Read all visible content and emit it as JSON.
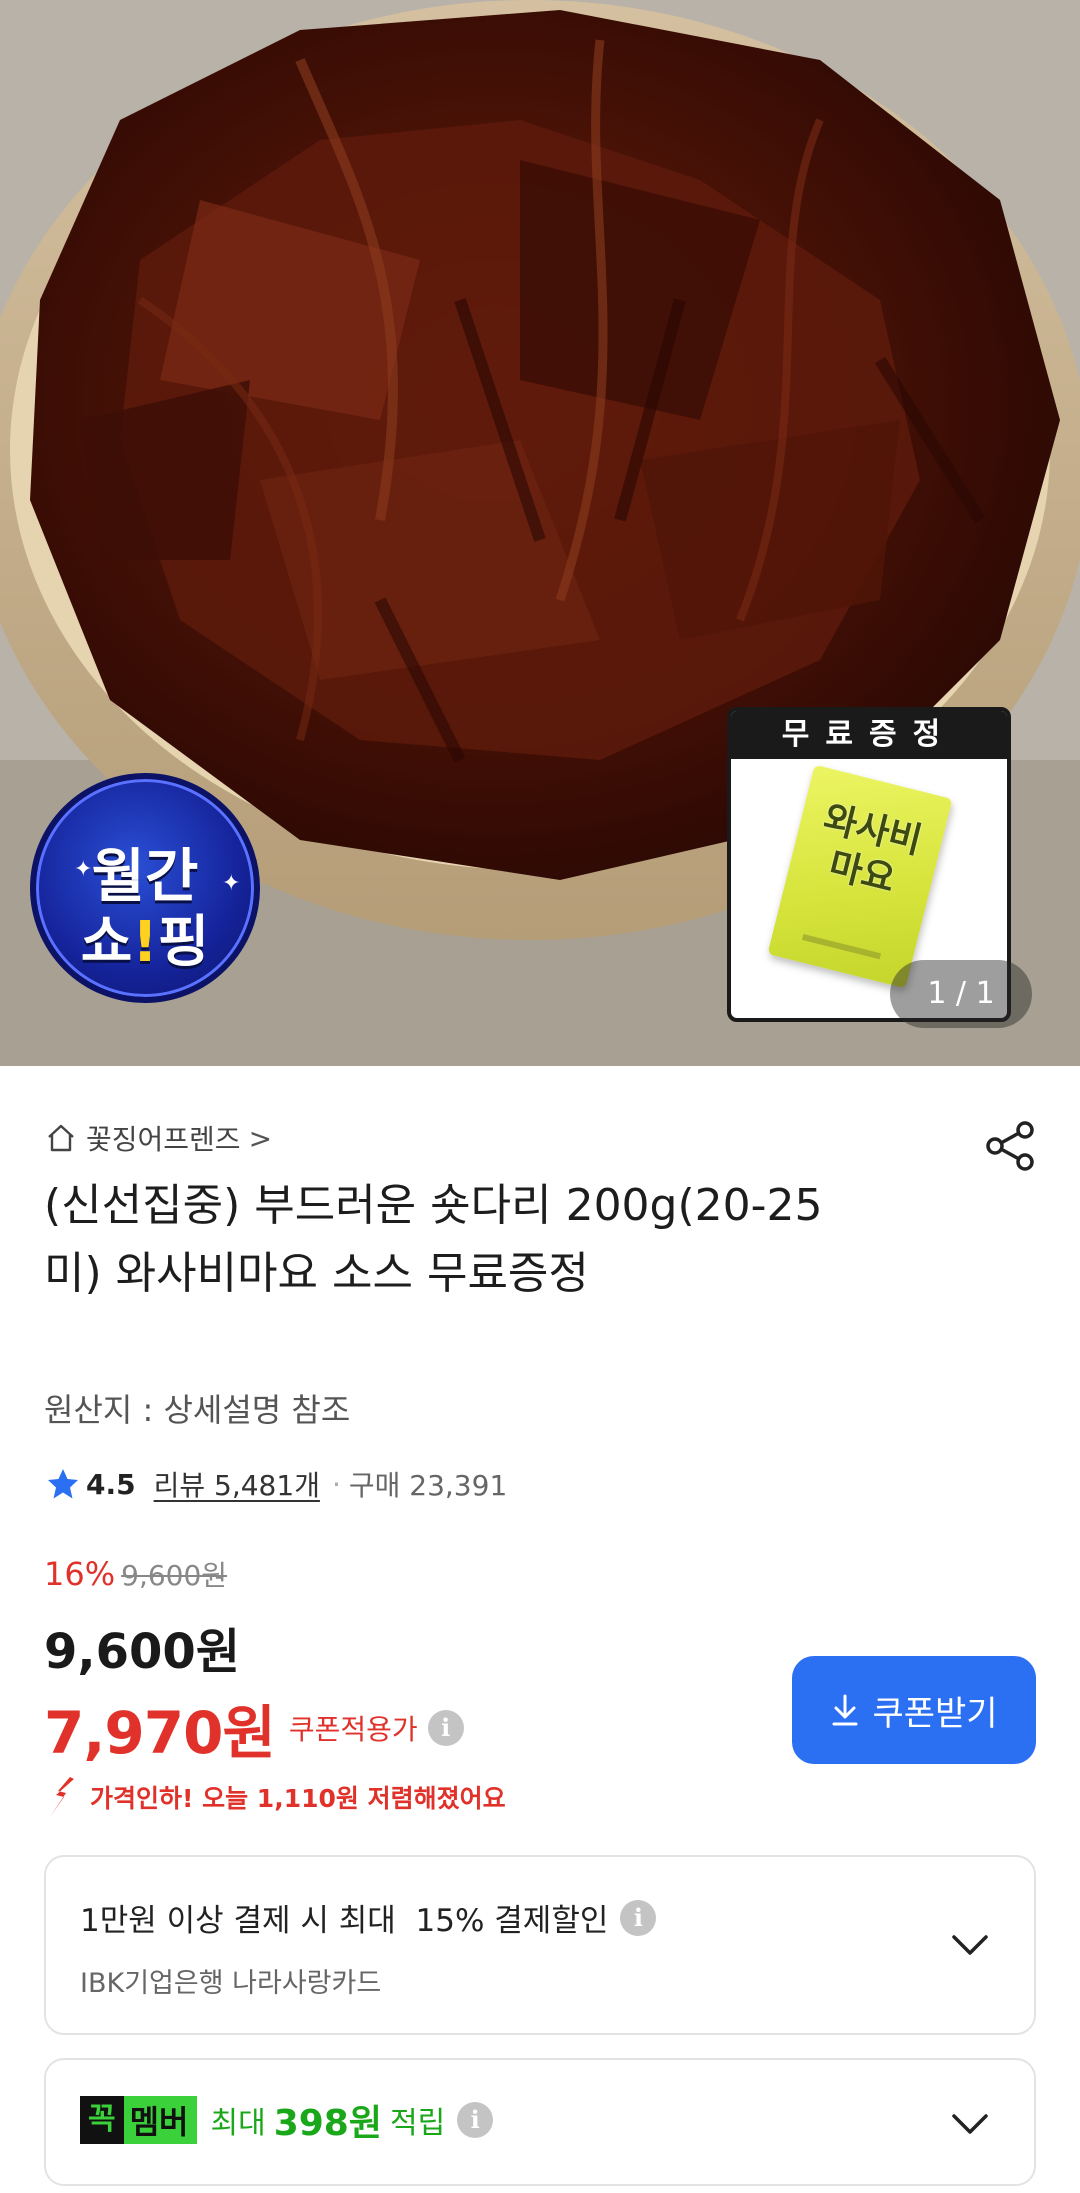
{
  "hero": {
    "gift_label": "무료증정",
    "sachet_text": "와사비마요",
    "pager": "1 / 1",
    "badge_line1": "월간",
    "badge_line2_a": "쇼",
    "badge_line2_excl": "!",
    "badge_line2_b": "핑"
  },
  "store": {
    "name": "꽃징어프렌즈",
    "chevron": ">"
  },
  "product": {
    "title": "(신선집중) 부드러운 숏다리 200g(20-25미) 와사비마요 소스 무료증정",
    "origin": "원산지 : 상세설명 참조"
  },
  "rating": {
    "score": "4.5",
    "reviews": "리뷰 5,481개",
    "separator": "·",
    "purchases": "구매 23,391"
  },
  "price": {
    "discount_pct": "16%",
    "original": "9,600원",
    "sale": "9,600원",
    "coupon_price": "7,970원",
    "coupon_label": "쿠폰적용가",
    "coupon_button": "쿠폰받기",
    "drop_notice": "가격인하! 오늘 1,110원 저렴해졌어요"
  },
  "card_discount": {
    "main": "1만원 이상 결제 시 최대  15% 결제할인",
    "sub": "IBK기업은행 나라사랑카드"
  },
  "member": {
    "logo_k": "꼭",
    "logo_m": "멤버",
    "prefix": "최대",
    "points": "398원",
    "suffix": "적립"
  },
  "colors": {
    "accent_red": "#e0322a",
    "button_blue": "#2b6ff3",
    "member_green": "#3ad13a"
  },
  "icons": [
    "home-icon",
    "share-icon",
    "star-icon",
    "info-icon",
    "download-icon",
    "price-drop-icon",
    "chevron-down-icon"
  ]
}
